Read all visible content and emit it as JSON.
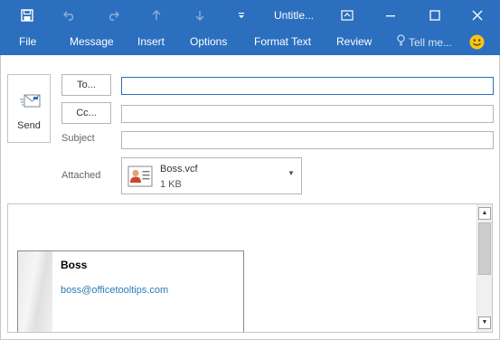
{
  "titlebar": {
    "title": "Untitle...",
    "icons": [
      "save-icon",
      "undo-icon",
      "redo-icon",
      "up-arrow-icon",
      "down-arrow-icon",
      "customize-quick-access-icon",
      "ribbon-display-options-icon",
      "minimize-icon",
      "maximize-icon",
      "close-icon"
    ]
  },
  "ribbon": {
    "tabs": [
      "File",
      "Message",
      "Insert",
      "Options",
      "Format Text",
      "Review"
    ],
    "tell_me": "Tell me...",
    "smiley": "☺"
  },
  "compose": {
    "send_label": "Send",
    "to_button": "To...",
    "cc_button": "Cc...",
    "subject_label": "Subject",
    "to_value": "",
    "cc_value": "",
    "subject_value": "",
    "attached_label": "Attached",
    "attachment": {
      "name": "Boss.vcf",
      "size": "1 KB"
    }
  },
  "body": {
    "card": {
      "name": "Boss",
      "email": "boss@officetooltips.com"
    }
  },
  "colors": {
    "accent": "#2b6fbe",
    "link": "#2a7bb8"
  }
}
